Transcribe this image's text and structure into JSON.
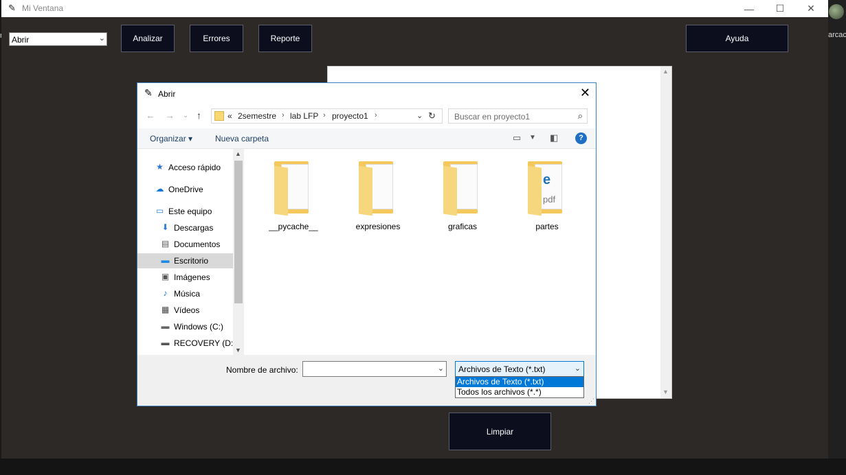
{
  "window": {
    "title": "Mi Ventana",
    "minimize": "—",
    "maximize": "☐",
    "close": "✕"
  },
  "main": {
    "combo_value": "Abrir",
    "buttons": {
      "analizar": "Analizar",
      "errores": "Errores",
      "reporte": "Reporte",
      "ayuda": "Ayuda",
      "limpiar": "Limpiar"
    }
  },
  "desktop": {
    "right_text": "arcac",
    "left_glyph": "r"
  },
  "dialog": {
    "title": "Abrir",
    "breadcrumb": [
      "«",
      "2semestre",
      "lab LFP",
      "proyecto1"
    ],
    "search_placeholder": "Buscar en proyecto1",
    "toolbar": {
      "organize": "Organizar ▾",
      "new_folder": "Nueva carpeta"
    },
    "nav_items": [
      {
        "label": "Acceso rápido",
        "icon": "star-icon",
        "glyph": "★",
        "color": "#2b78d0"
      },
      {
        "label": "OneDrive",
        "icon": "cloud-icon",
        "glyph": "☁",
        "color": "#1976d2"
      },
      {
        "label": "Este equipo",
        "icon": "computer-icon",
        "glyph": "▭",
        "color": "#2a7fd4"
      },
      {
        "label": "Descargas",
        "icon": "download-icon",
        "glyph": "⬇",
        "color": "#2d7fd6"
      },
      {
        "label": "Documentos",
        "icon": "document-icon",
        "glyph": "▤",
        "color": "#555"
      },
      {
        "label": "Escritorio",
        "icon": "desktop-icon",
        "glyph": "▬",
        "color": "#1e88e5"
      },
      {
        "label": "Imágenes",
        "icon": "image-icon",
        "glyph": "▣",
        "color": "#555"
      },
      {
        "label": "Música",
        "icon": "music-icon",
        "glyph": "♪",
        "color": "#1976d2"
      },
      {
        "label": "Vídeos",
        "icon": "video-icon",
        "glyph": "▦",
        "color": "#444"
      },
      {
        "label": "Windows (C:)",
        "icon": "drive-icon",
        "glyph": "▬",
        "color": "#666"
      },
      {
        "label": "RECOVERY (D:)",
        "icon": "drive-icon",
        "glyph": "▬",
        "color": "#555"
      }
    ],
    "selected_nav": "Escritorio",
    "folders": [
      {
        "name": "__pycache__"
      },
      {
        "name": "expresiones"
      },
      {
        "name": "graficas"
      },
      {
        "name": "partes",
        "badge": "e",
        "badge2": "pdf"
      }
    ],
    "filename_label": "Nombre de archivo:",
    "filename_value": "",
    "file_type_selected": "Archivos de Texto (*.txt)",
    "file_type_options": [
      "Archivos de Texto (*.txt)",
      "Todos los archivos (*.*)"
    ]
  }
}
